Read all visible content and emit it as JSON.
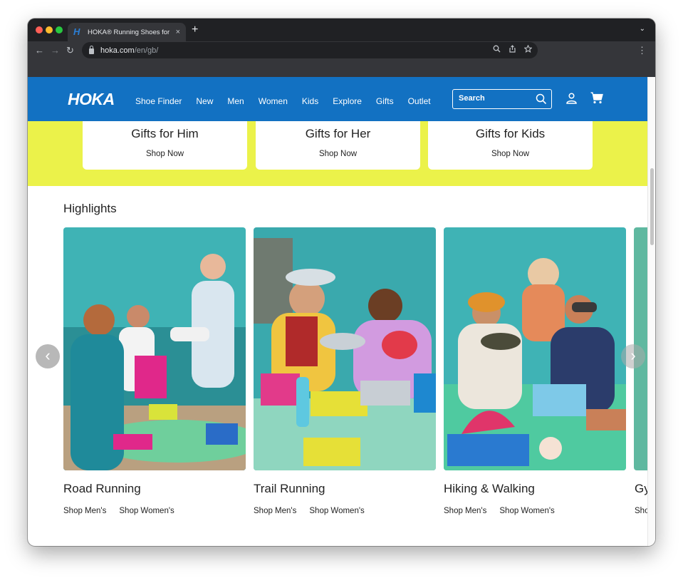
{
  "browser": {
    "tab_title": "HOKA® Running Shoes for Me",
    "tab_favicon": "H",
    "tab_close": "×",
    "new_tab": "+",
    "tab_menu": "⌄",
    "url_host": "hoka.com",
    "url_path": "/en/gb/",
    "back": "←",
    "forward": "→",
    "reload": "↻",
    "menu": "⋮"
  },
  "header": {
    "logo": "HOKA",
    "nav": [
      "Shoe Finder",
      "New",
      "Men",
      "Women",
      "Kids",
      "Explore",
      "Gifts",
      "Outlet"
    ],
    "search_placeholder": "Search"
  },
  "gifts": [
    {
      "title": "Gifts for Him",
      "link": "Shop Now"
    },
    {
      "title": "Gifts for Her",
      "link": "Shop Now"
    },
    {
      "title": "Gifts for Kids",
      "link": "Shop Now"
    }
  ],
  "highlights": {
    "title": "Highlights",
    "cards": [
      {
        "title": "Road Running",
        "link_men": "Shop Men's",
        "link_women": "Shop Women's"
      },
      {
        "title": "Trail Running",
        "link_men": "Shop Men's",
        "link_women": "Shop Women's"
      },
      {
        "title": "Hiking & Walking",
        "link_men": "Shop Men's",
        "link_women": "Shop Women's"
      }
    ],
    "peek_title": "Gy",
    "peek_link": "Sho",
    "prev": "‹",
    "next": "›"
  },
  "colors": {
    "brand_blue": "#1271c2",
    "gift_yellow": "#ebf24a"
  }
}
